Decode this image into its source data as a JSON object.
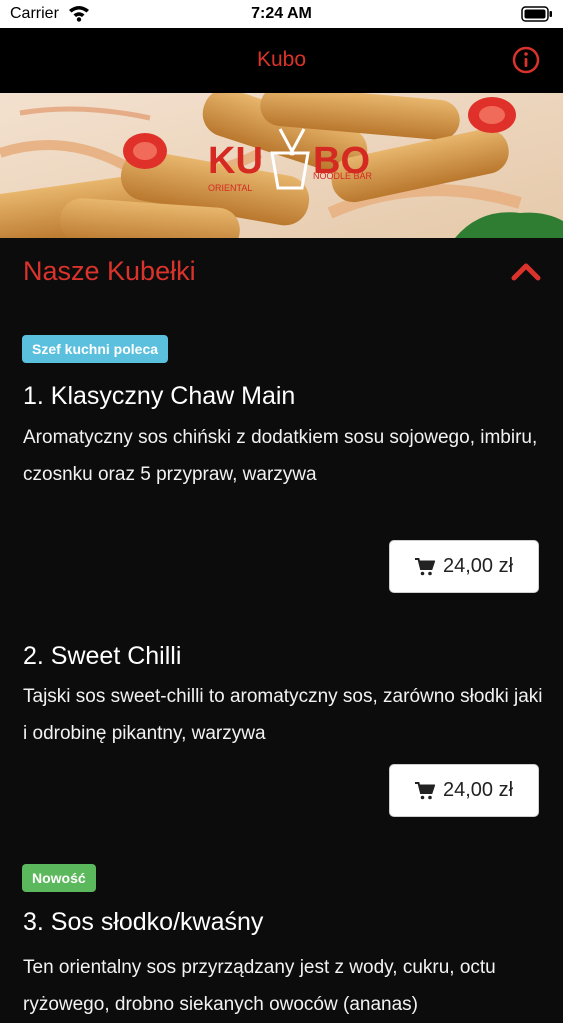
{
  "status_bar": {
    "carrier": "Carrier",
    "time": "7:24 AM"
  },
  "nav": {
    "title": "Kubo"
  },
  "hero": {
    "logo_text_left": "KU",
    "logo_text_right": "BO",
    "logo_sub_left": "ORIENTAL",
    "logo_sub_right": "NOODLE BAR"
  },
  "section": {
    "title": "Nasze Kubełki"
  },
  "items": [
    {
      "badge": "Szef kuchni poleca",
      "title": "1. Klasyczny Chaw Main",
      "description": "Aromatyczny sos chiński z dodatkiem sosu sojowego, imbiru, czosnku oraz 5 przypraw, warzywa",
      "price": "24,00 zł"
    },
    {
      "badge": "",
      "title": "2. Sweet Chilli",
      "description": "Tajski sos sweet-chilli to aromatyczny sos, zarówno słodki jaki i odrobinę pikantny, warzywa",
      "price": "24,00 zł"
    },
    {
      "badge": "Nowość",
      "title": "3. Sos słodko/kwaśny",
      "description": "Ten orientalny sos przyrządzany jest z wody, cukru, octu ryżowego, drobno siekanych owoców (ananas)"
    }
  ],
  "colors": {
    "accent": "#d9332b",
    "badge_chef": "#5bc0de",
    "badge_new": "#5cb85c",
    "background": "#0c0c0c"
  }
}
